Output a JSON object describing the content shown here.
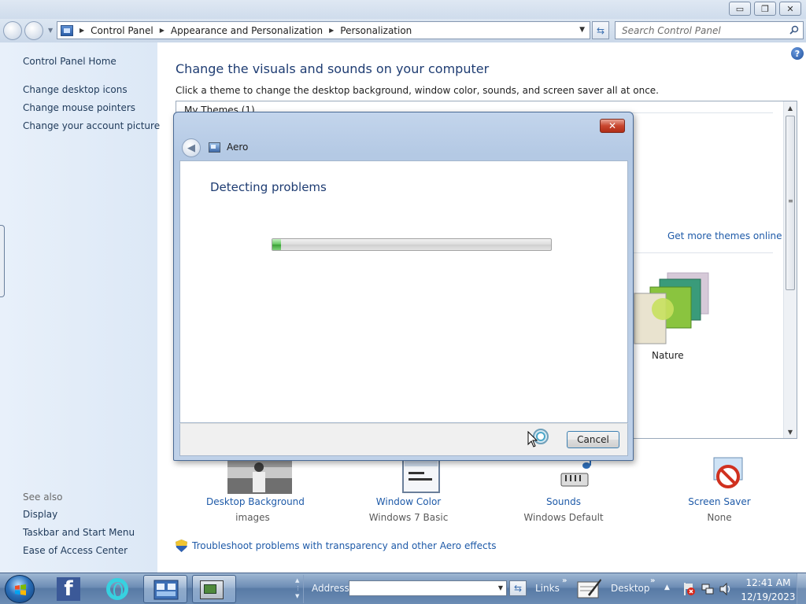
{
  "window": {
    "controls": {
      "minimize": "▭",
      "maximize": "❐",
      "close": "✕"
    }
  },
  "navbar": {
    "breadcrumbs": [
      "Control Panel",
      "Appearance and Personalization",
      "Personalization"
    ],
    "search_placeholder": "Search Control Panel",
    "refresh_icon": "⇆",
    "back_icon": "back-arrow-icon",
    "forward_icon": "forward-arrow-icon"
  },
  "sidebar": {
    "home": "Control Panel Home",
    "tasks": [
      "Change desktop icons",
      "Change mouse pointers",
      "Change your account picture"
    ],
    "see_also_title": "See also",
    "see_also": [
      "Display",
      "Taskbar and Start Menu",
      "Ease of Access Center"
    ]
  },
  "main": {
    "help_label": "?",
    "title": "Change the visuals and sounds on your computer",
    "subtitle": "Click a theme to change the desktop background, window color, sounds, and screen saver all at once.",
    "my_themes_label": "My Themes (1)",
    "get_more_link": "Get more themes online",
    "theme_label": "Nature",
    "bottom_items": [
      {
        "label": "Desktop Background",
        "sub": "images"
      },
      {
        "label": "Window Color",
        "sub": "Windows 7 Basic"
      },
      {
        "label": "Sounds",
        "sub": "Windows Default"
      },
      {
        "label": "Screen Saver",
        "sub": "None"
      }
    ],
    "troubleshoot_link": "Troubleshoot problems with transparency and other Aero effects"
  },
  "dialog": {
    "close_label": "✕",
    "back_label": "◀",
    "app_title": "Aero",
    "heading": "Detecting problems",
    "progress_fraction": 0.03,
    "cancel_label": "Cancel"
  },
  "taskbar": {
    "address_label": "Address",
    "address_value": "",
    "links_label": "Links",
    "desktop_label": "Desktop",
    "chevron": "»",
    "facebook_glyph": "f",
    "time": "12:41 AM",
    "date": "12/19/2023"
  },
  "colors": {
    "link": "#1e5aa8",
    "heading": "#1e3c72",
    "progress_green": "#3aa036",
    "taskbar": "#587aa5"
  }
}
